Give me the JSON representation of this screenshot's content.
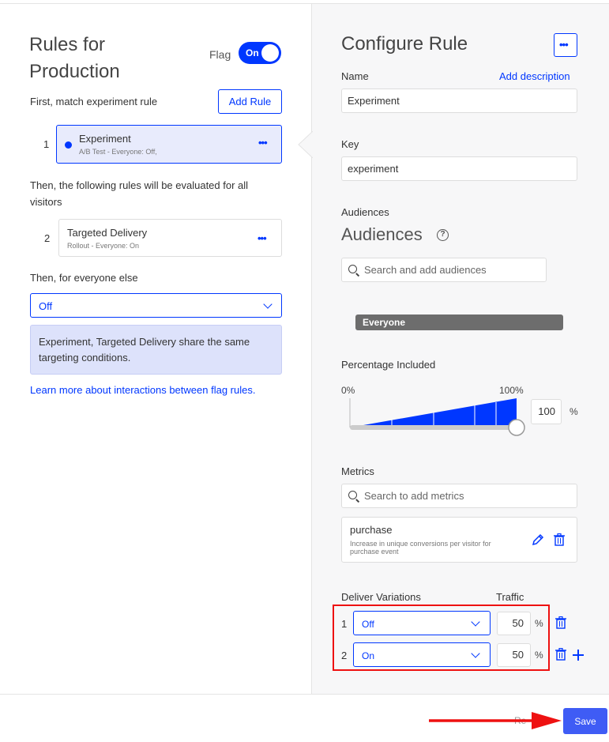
{
  "left": {
    "title_line1": "Rules for",
    "title_line2": "Production",
    "flag_label": "Flag",
    "flag_toggle": "On",
    "match_label": "First, match experiment rule",
    "add_rule_button": "Add Rule",
    "rules_top": [
      {
        "num": "1",
        "name": "Experiment",
        "sub": "A/B Test - Everyone: Off,"
      }
    ],
    "following_label": "Then, the following rules will be evaluated for all visitors",
    "following_label_1": "Then, the following rules will be evaluated for all",
    "following_label_2": "visitors",
    "rules_following": [
      {
        "num": "2",
        "name": "Targeted Delivery",
        "sub": "Rollout - Everyone: On"
      }
    ],
    "everyone_else_label": "Then, for everyone else",
    "everyone_else_value": "Off",
    "info_text": "Experiment, Targeted Delivery share the same targeting conditions.",
    "learn_more_link": "Learn more about interactions between flag rules."
  },
  "right": {
    "title": "Configure Rule",
    "name_label": "Name",
    "add_description_link": "Add description",
    "name_value": "Experiment",
    "key_label": "Key",
    "key_value": "experiment",
    "audiences_label": "Audiences",
    "audiences_heading": "Audiences",
    "audience_search_placeholder": "Search and add audiences",
    "audience_selected": "Everyone",
    "percentage_label": "Percentage Included",
    "slider_min_label": "0%",
    "slider_max_label": "100%",
    "percentage_value": "100",
    "percentage_unit": "%",
    "percentage_level": 1.0,
    "metrics_label": "Metrics",
    "metrics_search_placeholder": "Search to add metrics",
    "metric": {
      "name": "purchase",
      "desc": "Increase in unique conversions per visitor for purchase event"
    },
    "deliver_label": "Deliver Variations",
    "traffic_label": "Traffic",
    "variations": [
      {
        "num": "1",
        "value": "Off",
        "traffic": "50",
        "unit": "%"
      },
      {
        "num": "2",
        "value": "On",
        "traffic": "50",
        "unit": "%"
      }
    ]
  },
  "footer": {
    "reset_partial": "Re",
    "save_button": "Save"
  },
  "colors": {
    "accent": "#0037ff",
    "annotation_red": "#ee1111",
    "save_button": "#3f5cf5"
  },
  "icons": [
    "more-dots-icon",
    "help-icon",
    "search-icon",
    "pencil-icon",
    "trash-icon",
    "plus-icon",
    "chevron-down-icon"
  ]
}
